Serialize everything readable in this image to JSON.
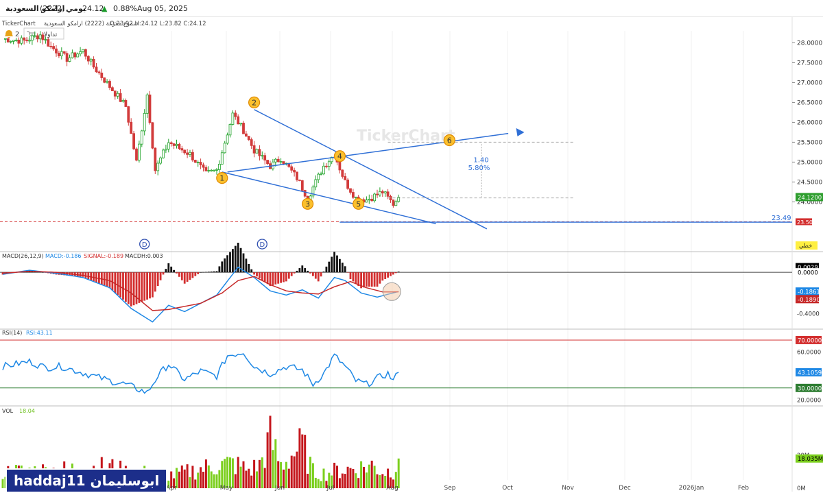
{
  "header": {
    "name": "ارامكو السعودية",
    "code": "(2222)",
    "period": "يومي",
    "price": "24.12",
    "change_arrow": "▲",
    "change_pct": "0.88%",
    "date": "Aug 05, 2025"
  },
  "chart_header": {
    "source": "TickerChart",
    "description": "شموع مفرغة (2222) ارامكو السعودية",
    "ohlc": "O:23.92  H:24.12  L:23.82  C:24.12"
  },
  "toolbar": {
    "alert_count": "2",
    "tadawulati_label": "تداولاتي"
  },
  "watermark_text": "TickerChart",
  "author": "haddaj11 ابوسليمان",
  "chart_data": [
    {
      "panel": "price",
      "type": "candlestick",
      "x_range_labels": [
        "Apr",
        "May",
        "Jun",
        "Jul",
        "Aug",
        "Sep",
        "Oct",
        "Nov",
        "Dec",
        "2026Jan",
        "Feb"
      ],
      "y_ticks": [
        "28.0000",
        "27.5000",
        "27.0000",
        "26.5000",
        "26.0000",
        "25.5000",
        "25.0000",
        "24.5000",
        "24.0000"
      ],
      "ylim": [
        23.3,
        28.3
      ],
      "last_price_label": "24.1200",
      "price_line_value": "23.49",
      "support_label": "23.50",
      "line_style_label": "خطي",
      "dividend_markers": [
        "D",
        "D"
      ],
      "wave_labels": [
        "1",
        "2",
        "3",
        "4",
        "5",
        "6"
      ],
      "measure_change": "1.40",
      "measure_pct": "5.80%",
      "series": [
        {
          "anchors": [
            [
              0,
              28.1
            ],
            [
              8,
              28.05
            ],
            [
              14,
              28.2
            ],
            [
              18,
              27.9
            ],
            [
              24,
              27.6
            ],
            [
              30,
              27.8
            ],
            [
              34,
              27.4
            ],
            [
              40,
              26.9
            ],
            [
              46,
              26.4
            ],
            [
              50,
              25.0
            ],
            [
              54,
              26.7
            ],
            [
              57,
              24.8
            ],
            [
              62,
              25.5
            ],
            [
              70,
              25.2
            ],
            [
              76,
              24.7
            ],
            [
              80,
              24.8
            ],
            [
              86,
              26.2
            ],
            [
              90,
              25.8
            ],
            [
              94,
              25.3
            ],
            [
              100,
              24.9
            ],
            [
              104,
              25.1
            ],
            [
              110,
              24.6
            ],
            [
              114,
              24.1
            ],
            [
              120,
              24.9
            ],
            [
              124,
              25.2
            ],
            [
              128,
              24.5
            ],
            [
              132,
              24.1
            ],
            [
              136,
              24.05
            ],
            [
              142,
              24.25
            ],
            [
              146,
              23.95
            ],
            [
              148,
              24.12
            ]
          ]
        }
      ]
    },
    {
      "panel": "macd",
      "type": "macd",
      "label": "MACD(26,12,9)",
      "macd_value": "MACD:-0.186",
      "signal_value": "SIGNAL:-0.189",
      "macdh_value": "MACDH:0.003",
      "y_ticks": [
        "0.0000",
        "-0.4000"
      ],
      "ylim": [
        -0.55,
        0.18
      ],
      "axis_labels": [
        "0.0029",
        "0.0000",
        "-0.1861",
        "-0.1890"
      ],
      "series": [
        {
          "name": "macd",
          "anchors": [
            [
              0,
              -0.02
            ],
            [
              10,
              0.02
            ],
            [
              20,
              -0.01
            ],
            [
              30,
              -0.05
            ],
            [
              40,
              -0.15
            ],
            [
              48,
              -0.35
            ],
            [
              56,
              -0.48
            ],
            [
              62,
              -0.32
            ],
            [
              68,
              -0.38
            ],
            [
              74,
              -0.3
            ],
            [
              80,
              -0.22
            ],
            [
              88,
              0.05
            ],
            [
              94,
              -0.05
            ],
            [
              100,
              -0.18
            ],
            [
              106,
              -0.22
            ],
            [
              112,
              -0.17
            ],
            [
              118,
              -0.25
            ],
            [
              124,
              -0.05
            ],
            [
              128,
              -0.08
            ],
            [
              134,
              -0.2
            ],
            [
              140,
              -0.24
            ],
            [
              148,
              -0.186
            ]
          ]
        },
        {
          "name": "signal",
          "anchors": [
            [
              0,
              -0.01
            ],
            [
              10,
              0.01
            ],
            [
              20,
              0.0
            ],
            [
              30,
              -0.03
            ],
            [
              40,
              -0.08
            ],
            [
              48,
              -0.2
            ],
            [
              56,
              -0.37
            ],
            [
              62,
              -0.36
            ],
            [
              68,
              -0.33
            ],
            [
              74,
              -0.3
            ],
            [
              82,
              -0.2
            ],
            [
              88,
              -0.08
            ],
            [
              94,
              -0.04
            ],
            [
              100,
              -0.12
            ],
            [
              106,
              -0.18
            ],
            [
              112,
              -0.2
            ],
            [
              118,
              -0.21
            ],
            [
              124,
              -0.14
            ],
            [
              130,
              -0.09
            ],
            [
              136,
              -0.15
            ],
            [
              142,
              -0.19
            ],
            [
              148,
              -0.189
            ]
          ]
        }
      ]
    },
    {
      "panel": "rsi",
      "type": "line",
      "label": "RSI(14)",
      "rsi_value": "RSI:43.11",
      "y_ticks": [
        "60.0000",
        "20.0000"
      ],
      "ylim": [
        15,
        78
      ],
      "axis_labels": [
        "70.0000",
        "43.1059",
        "30.0000"
      ],
      "series": [
        {
          "name": "rsi",
          "anchors": [
            [
              0,
              48
            ],
            [
              10,
              52
            ],
            [
              16,
              47
            ],
            [
              22,
              48
            ],
            [
              28,
              44
            ],
            [
              34,
              40
            ],
            [
              40,
              36
            ],
            [
              46,
              33
            ],
            [
              54,
              26
            ],
            [
              58,
              40
            ],
            [
              62,
              50
            ],
            [
              68,
              37
            ],
            [
              74,
              44
            ],
            [
              80,
              40
            ],
            [
              84,
              57
            ],
            [
              90,
              60
            ],
            [
              94,
              48
            ],
            [
              100,
              42
            ],
            [
              106,
              48
            ],
            [
              112,
              45
            ],
            [
              116,
              33
            ],
            [
              120,
              42
            ],
            [
              124,
              57
            ],
            [
              128,
              48
            ],
            [
              132,
              36
            ],
            [
              136,
              33
            ],
            [
              140,
              38
            ],
            [
              144,
              42
            ],
            [
              146,
              36
            ],
            [
              148,
              43.11
            ]
          ]
        }
      ]
    },
    {
      "panel": "volume",
      "type": "bar",
      "label": "VOL",
      "vol_value": "18.04",
      "y_ticks": [
        "20M",
        "0M"
      ],
      "ylim": [
        0,
        40
      ],
      "last_volume_label": "18.035M",
      "series": [
        {
          "anchors": [
            [
              0,
              10
            ],
            [
              20,
              11
            ],
            [
              40,
              13
            ],
            [
              46,
              10
            ],
            [
              56,
              9
            ],
            [
              64,
              8
            ],
            [
              72,
              11
            ],
            [
              80,
              14
            ],
            [
              86,
              15
            ],
            [
              92,
              11
            ],
            [
              96,
              14
            ],
            [
              100,
              30
            ],
            [
              104,
              14
            ],
            [
              108,
              20
            ],
            [
              112,
              26
            ],
            [
              116,
              10
            ],
            [
              120,
              9
            ],
            [
              126,
              11
            ],
            [
              132,
              12
            ],
            [
              138,
              14
            ],
            [
              142,
              10
            ],
            [
              146,
              11
            ],
            [
              148,
              18.04
            ]
          ]
        }
      ]
    }
  ]
}
